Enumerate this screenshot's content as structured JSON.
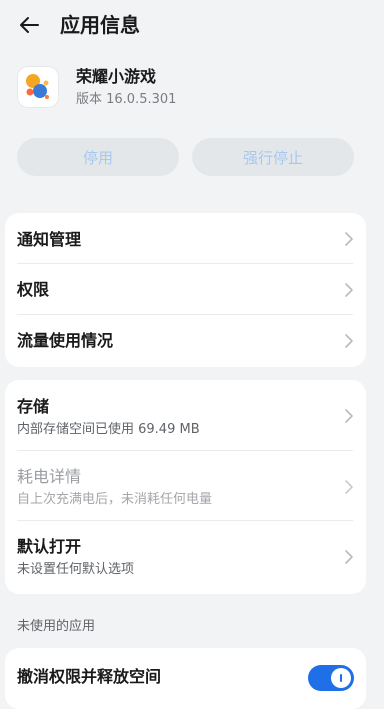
{
  "header": {
    "title": "应用信息",
    "back_icon": "arrow-left-icon"
  },
  "app": {
    "name": "荣耀小游戏",
    "version": "版本 16.0.5.301",
    "icon": "app-logo-icon"
  },
  "actions": {
    "disable_label": "停用",
    "force_stop_label": "强行停止",
    "disabled_color": "#a6c8f0"
  },
  "group1": {
    "items": [
      {
        "label": "通知管理"
      },
      {
        "label": "权限"
      },
      {
        "label": "流量使用情况"
      }
    ]
  },
  "group2": {
    "items": [
      {
        "label": "存储",
        "sub": "内部存储空间已使用 69.49 MB"
      },
      {
        "label": "耗电详情",
        "sub": "自上次充满电后，未消耗任何电量",
        "disabled": true
      },
      {
        "label": "默认打开",
        "sub": "未设置任何默认选项"
      }
    ]
  },
  "unused_section": {
    "label": "未使用的应用",
    "toggle_label": "撤消权限并释放空间",
    "toggle_on": true,
    "accent": "#1e6fe8"
  }
}
